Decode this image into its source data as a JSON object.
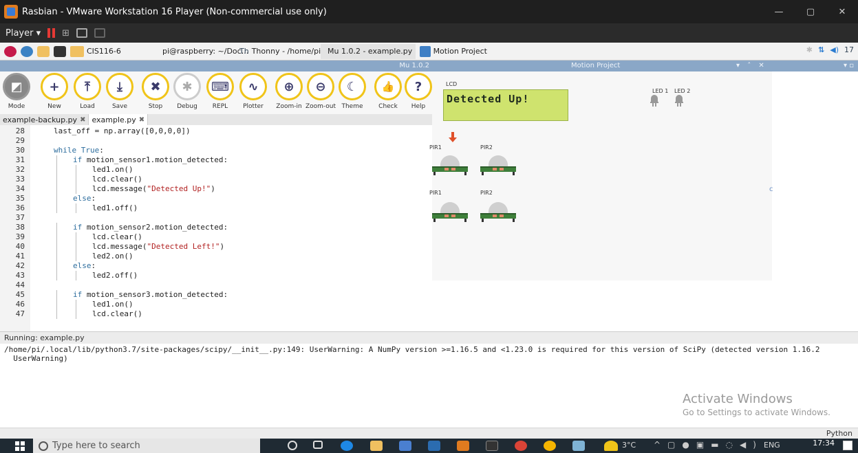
{
  "vm": {
    "title": "Rasbian - VMware Workstation 16 Player (Non-commercial use only)",
    "menu_player": "Player",
    "controls": [
      "minimize",
      "maximize",
      "close"
    ]
  },
  "pi_taskbar": {
    "tasks": [
      {
        "label": "CIS116-6",
        "icon": "folder-icon"
      },
      {
        "label": "pi@raspberry: ~/Doc...",
        "icon": "terminal-icon"
      },
      {
        "label": "Thonny - /home/pi/...",
        "icon": "thonny-icon"
      },
      {
        "label": "Mu 1.0.2 - example.py",
        "icon": "mu-icon"
      },
      {
        "label": "Motion Project",
        "icon": "window-icon"
      }
    ],
    "tray_time": "17"
  },
  "mu": {
    "window_title": "Mu 1.0.2",
    "toolbar": [
      {
        "label": "Mode",
        "glyph": "◩",
        "icon": "mode-icon"
      },
      {
        "label": "New",
        "glyph": "+",
        "icon": "plus-icon"
      },
      {
        "label": "Load",
        "glyph": "⤒",
        "icon": "upload-icon"
      },
      {
        "label": "Save",
        "glyph": "⤓",
        "icon": "download-icon"
      },
      {
        "label": "Stop",
        "glyph": "✖",
        "icon": "stop-icon"
      },
      {
        "label": "Debug",
        "glyph": "✱",
        "icon": "bug-icon"
      },
      {
        "label": "REPL",
        "glyph": "⌨",
        "icon": "keyboard-icon"
      },
      {
        "label": "Plotter",
        "glyph": "∿",
        "icon": "pulse-icon"
      },
      {
        "label": "Zoom-in",
        "glyph": "⊕",
        "icon": "zoom-in-icon"
      },
      {
        "label": "Zoom-out",
        "glyph": "⊖",
        "icon": "zoom-out-icon"
      },
      {
        "label": "Theme",
        "glyph": "☾",
        "icon": "moon-icon"
      },
      {
        "label": "Check",
        "glyph": "👍",
        "icon": "thumbs-up-icon"
      },
      {
        "label": "Help",
        "glyph": "?",
        "icon": "help-icon"
      }
    ],
    "tabs": [
      {
        "label": "example-backup.py",
        "active": false
      },
      {
        "label": "example.py",
        "active": true
      }
    ],
    "code_lines": [
      {
        "n": "28",
        "indent": 0,
        "text": "last_off = np.array([0,0,0,0])"
      },
      {
        "n": "29",
        "indent": 0,
        "text": ""
      },
      {
        "n": "30",
        "indent": 0,
        "text": "while True:"
      },
      {
        "n": "31",
        "indent": 1,
        "text": "if motion_sensor1.motion_detected:"
      },
      {
        "n": "32",
        "indent": 2,
        "text": "led1.on()"
      },
      {
        "n": "33",
        "indent": 2,
        "text": "lcd.clear()"
      },
      {
        "n": "34",
        "indent": 2,
        "text": "lcd.message(\"Detected Up!\")"
      },
      {
        "n": "35",
        "indent": 1,
        "text": "else:"
      },
      {
        "n": "36",
        "indent": 2,
        "text": "led1.off()"
      },
      {
        "n": "37",
        "indent": 0,
        "text": ""
      },
      {
        "n": "38",
        "indent": 1,
        "text": "if motion_sensor2.motion_detected:"
      },
      {
        "n": "39",
        "indent": 2,
        "text": "lcd.clear()"
      },
      {
        "n": "40",
        "indent": 2,
        "text": "lcd.message(\"Detected Left!\")"
      },
      {
        "n": "41",
        "indent": 2,
        "text": "led2.on()"
      },
      {
        "n": "42",
        "indent": 1,
        "text": "else:"
      },
      {
        "n": "43",
        "indent": 2,
        "text": "led2.off()"
      },
      {
        "n": "44",
        "indent": 0,
        "text": ""
      },
      {
        "n": "45",
        "indent": 1,
        "text": "if motion_sensor3.motion_detected:"
      },
      {
        "n": "46",
        "indent": 2,
        "text": "led1.on()"
      },
      {
        "n": "47",
        "indent": 2,
        "text": "lcd.clear()"
      }
    ],
    "status": "Running: example.py",
    "console": "/home/pi/.local/lib/python3.7/site-packages/scipy/__init__.py:149: UserWarning: A NumPy version >=1.16.5 and <1.23.0 is required for this version of SciPy (detected version 1.16.2\n  UserWarning)",
    "mode": "Python"
  },
  "motion": {
    "window_title": "Motion Project",
    "lcd_label": "LCD",
    "lcd_text": "Detected Up!",
    "led1_label": "LED 1",
    "led2_label": "LED 2",
    "pir_row1": [
      "PIR1",
      "PIR2"
    ],
    "pir_row2": [
      "PIR1",
      "PIR2"
    ],
    "stray_c": "c"
  },
  "activate": {
    "title": "Activate Windows",
    "sub": "Go to Settings to activate Windows."
  },
  "win_taskbar": {
    "search_placeholder": "Type here to search",
    "temp": "3°C",
    "lang": "ENG",
    "time": "17:34"
  },
  "colors": {
    "accent": "#f0c419",
    "lcd": "#cfe36e",
    "titlebar": "#8aa7c7"
  }
}
